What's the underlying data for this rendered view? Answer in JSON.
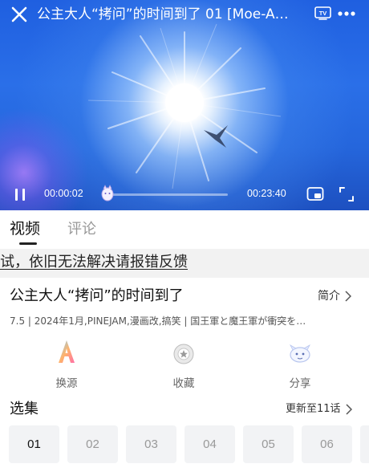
{
  "player": {
    "title": "公主大人“拷问”的时间到了 01 [Moe-A…",
    "current_time": "00:00:02",
    "total_time": "00:23:40",
    "progress": 0.001,
    "icons": {
      "close": "close-icon",
      "tv": "tv-cast-icon",
      "more": "more-dots-icon",
      "pause": "pause-icon",
      "pip": "picture-in-picture-icon",
      "fullscreen": "fullscreen-icon"
    },
    "tv_badge": "TV"
  },
  "tabs": {
    "video": "视频",
    "comments": "评论"
  },
  "notice": {
    "text": "试，依旧无法解决请报错反馈"
  },
  "info": {
    "title": "公主大人“拷问”的时间到了",
    "intro_label": "简介",
    "meta": "7.5 | 2024年1月,PINEJAM,漫画改,搞笑 | 国王軍と魔王軍が衝突を…"
  },
  "actions": [
    {
      "label": "换源",
      "icon": "source-switch-icon"
    },
    {
      "label": "收藏",
      "icon": "favorite-icon"
    },
    {
      "label": "分享",
      "icon": "share-icon"
    }
  ],
  "episodes": {
    "header": "选集",
    "update_label": "更新至11话",
    "items": [
      "01",
      "02",
      "03",
      "04",
      "05",
      "06"
    ],
    "active": "01"
  },
  "colors": {
    "sky_blue": "#2a6fe8",
    "chip_bg": "#f2f3f5",
    "notice_bg": "#f2f2f2"
  }
}
